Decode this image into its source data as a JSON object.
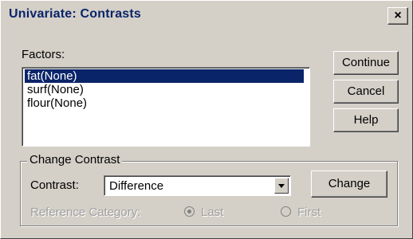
{
  "dialog": {
    "title": "Univariate: Contrasts",
    "close_label": "×"
  },
  "factors": {
    "label": "Factors:",
    "items": [
      "fat(None)",
      "surf(None)",
      "flour(None)"
    ],
    "selected_index": 0
  },
  "buttons": {
    "continue": "Continue",
    "cancel": "Cancel",
    "help": "Help",
    "change": "Change"
  },
  "change_contrast": {
    "group_label": "Change Contrast",
    "contrast_label": "Contrast:",
    "contrast_value": "Difference",
    "reference_label": "Reference Category:",
    "options": [
      {
        "label": "Last",
        "selected": true
      },
      {
        "label": "First",
        "selected": false
      }
    ]
  },
  "colors": {
    "face": "#d4d0c8",
    "selection": "#0a246a",
    "title_text": "#0a246a",
    "disabled_text": "#a0a0a0"
  }
}
